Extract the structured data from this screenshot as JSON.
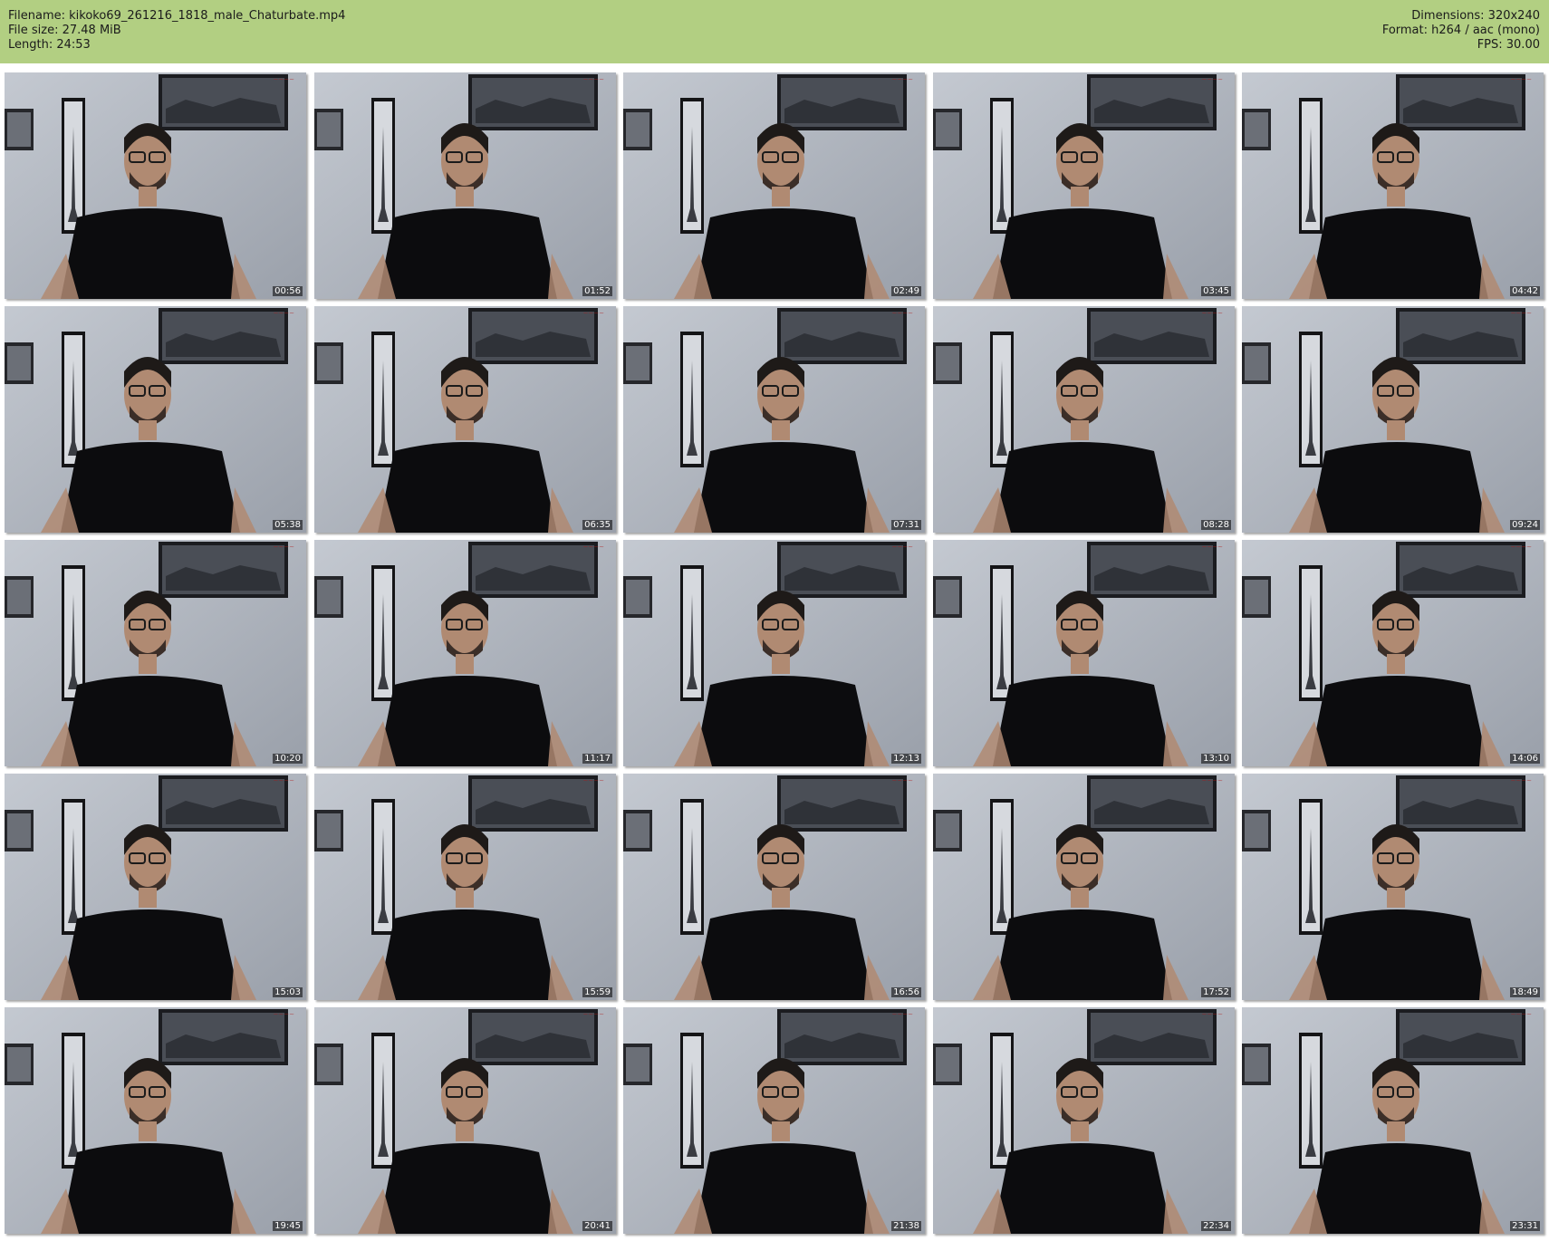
{
  "info": {
    "filename": "Filename: kikoko69_261216_1818_male_Chaturbate.mp4",
    "filesize": "File size: 27.48 MiB",
    "length": "Length: 24:53",
    "dimensions": "Dimensions: 320x240",
    "format": "Format: h264 / aac (mono)",
    "fps": "FPS: 30.00"
  },
  "colors": {
    "header_bg": "#b2cf82",
    "wall": "#aeb3bd",
    "shirt": "#0c0c0e",
    "skin": "#b08a72",
    "hair": "#1e1a18"
  },
  "thumbnails": [
    {
      "time": "00:56"
    },
    {
      "time": "01:52"
    },
    {
      "time": "02:49"
    },
    {
      "time": "03:45"
    },
    {
      "time": "04:42"
    },
    {
      "time": "05:38"
    },
    {
      "time": "06:35"
    },
    {
      "time": "07:31"
    },
    {
      "time": "08:28"
    },
    {
      "time": "09:24"
    },
    {
      "time": "10:20"
    },
    {
      "time": "11:17"
    },
    {
      "time": "12:13"
    },
    {
      "time": "13:10"
    },
    {
      "time": "14:06"
    },
    {
      "time": "15:03"
    },
    {
      "time": "15:59"
    },
    {
      "time": "16:56"
    },
    {
      "time": "17:52"
    },
    {
      "time": "18:49"
    },
    {
      "time": "19:45"
    },
    {
      "time": "20:41"
    },
    {
      "time": "21:38"
    },
    {
      "time": "22:34"
    },
    {
      "time": "23:31"
    }
  ]
}
